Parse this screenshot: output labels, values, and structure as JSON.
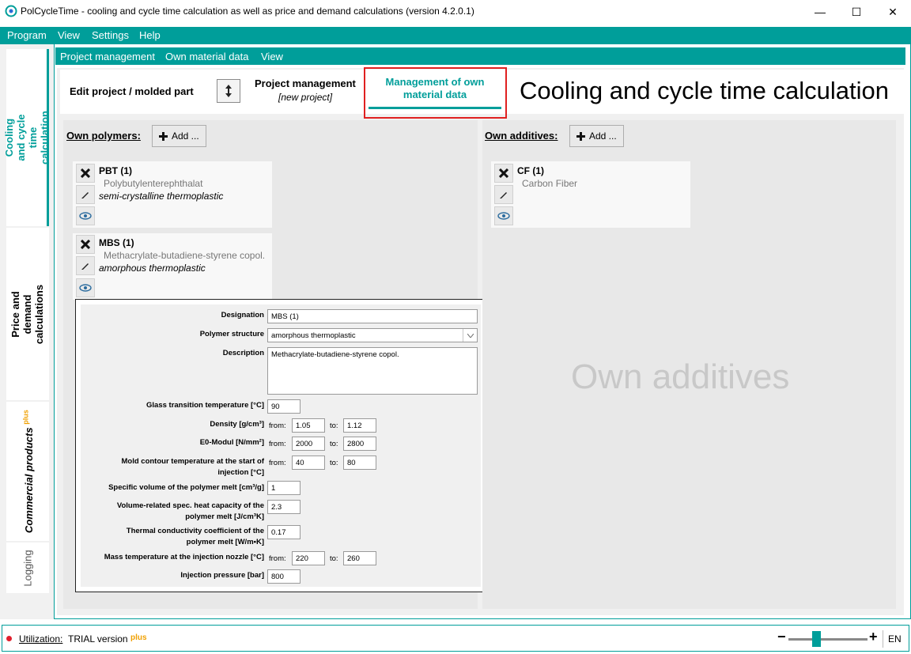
{
  "window": {
    "title": "PolCycleTime - cooling and cycle time calculation as well as price and demand calculations (version 4.2.0.1)",
    "minimize": "—",
    "maximize": "☐",
    "close": "✕"
  },
  "menu": [
    "Program",
    "View",
    "Settings",
    "Help"
  ],
  "sidebar": {
    "tabs": [
      {
        "label": "Cooling and cycle time calculation"
      },
      {
        "label": "Price and demand calculations"
      },
      {
        "label": "Commercial products",
        "badge": "plus"
      },
      {
        "label": "Logging"
      }
    ]
  },
  "submenu": [
    "Project management",
    "Own material data",
    "View"
  ],
  "header": {
    "edit_project": "Edit project / molded part",
    "project_management": "Project management",
    "new_project": "[new project]",
    "own_material_tab_line1": "Management of own",
    "own_material_tab_line2": "material data",
    "big_title": "Cooling and cycle time calculation"
  },
  "polymers": {
    "heading": "Own polymers:",
    "add_label": "Add ...",
    "items": [
      {
        "name": "PBT (1)",
        "full_name": "Polybutylenterephthalat",
        "structure": "semi-crystalline thermoplastic"
      },
      {
        "name": "MBS (1)",
        "full_name": "Methacrylate-butadiene-styrene copol.",
        "structure": "amorphous thermoplastic"
      }
    ]
  },
  "additives": {
    "heading": "Own additives:",
    "add_label": "Add ...",
    "items": [
      {
        "name": "CF (1)",
        "full_name": "Carbon Fiber"
      }
    ],
    "watermark": "Own additives"
  },
  "form": {
    "designation_label": "Designation",
    "designation_value": "MBS (1)",
    "structure_label": "Polymer structure",
    "structure_value": "amorphous thermoplastic",
    "description_label": "Description",
    "description_value": "Methacrylate-butadiene-styrene copol.",
    "glass_label": "Glass transition temperature [°C]",
    "glass_value": "90",
    "density_label": "Density [g/cm³]",
    "density_from": "1.05",
    "density_to": "1.12",
    "e0_label": "E0-Modul [N/mm²]",
    "e0_from": "2000",
    "e0_to": "2800",
    "mold_label_1": "Mold contour temperature at the start of",
    "mold_label_2": "injection [°C]",
    "mold_from": "40",
    "mold_to": "80",
    "specvol_label": "Specific volume of the polymer melt [cm³/g]",
    "specvol_value": "1",
    "heatcap_label_1": "Volume-related spec. heat capacity of the",
    "heatcap_label_2": "polymer melt [J/cm³K]",
    "heatcap_value": "2.3",
    "thermal_label_1": "Thermal conductivity coefficient of the",
    "thermal_label_2": "polymer melt [W/m•K]",
    "thermal_value": "0.17",
    "mass_label": "Mass temperature at the injection nozzle [°C]",
    "mass_from": "220",
    "mass_to": "260",
    "injection_label": "Injection pressure [bar]",
    "injection_value": "800",
    "from_text": "from:",
    "to_text": "to:"
  },
  "status": {
    "utilization_label": "Utilization:",
    "version_text": "TRIAL version",
    "plus": "plus",
    "language": "EN",
    "minus_sign": "−",
    "plus_sign": "+"
  },
  "colors": {
    "accent": "#009e9a",
    "highlight": "#e02020",
    "plus_badge": "#f0a000",
    "status_dot": "#e0202e"
  }
}
